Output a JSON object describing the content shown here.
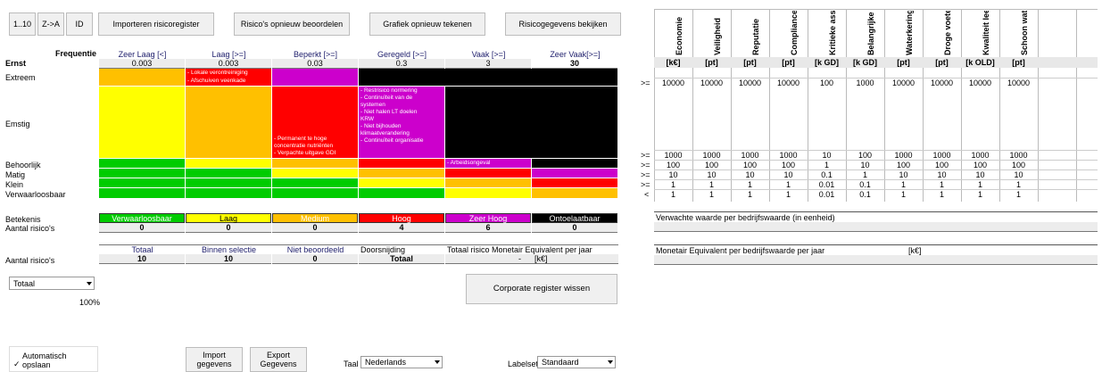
{
  "toolbar": {
    "sort_num": "1..10",
    "sort_az": "Z->A",
    "sort_id": "ID",
    "import_register": "Importeren risicoregister",
    "reassess": "Risico's opnieuw beoordelen",
    "redraw": "Grafiek opnieuw tekenen",
    "view_data": "Risicogegevens bekijken"
  },
  "matrix": {
    "frequency_label": "Frequentie",
    "severity_label": "Ernst",
    "freq_headers": [
      "Zeer Laag [<]",
      "Laag [>=]",
      "Beperkt [>=]",
      "Geregeld [>=]",
      "Vaak [>=]",
      "Zeer Vaak[>=]"
    ],
    "freq_values": [
      "0.003",
      "0.003",
      "0.03",
      "0.3",
      "3",
      "30"
    ],
    "row_labels": [
      "Extreem",
      "Emstig",
      "Behoorlijk",
      "Matig",
      "Klein",
      "Verwaarloosbaar"
    ],
    "cell_texts": {
      "extreem_laag": [
        "- Lokale verontreiniging",
        "- Afschuiven veenkade"
      ],
      "emstig_beperkt": [
        "- Permanent te hoge",
        "concentratie nutriënten",
        "- Verpachte uitgave GDI"
      ],
      "emstig_geregeld": [
        "- Restrisico normering",
        "- Continuïteit van de",
        "systemen",
        "- Niet halen LT doelen",
        "KRW",
        "- Niet bijhouden",
        "klimaatverandering",
        "- Continuïteit organisatie"
      ],
      "behoorlijk_vaak": [
        "- Arbeidsongeval"
      ]
    }
  },
  "legend": {
    "meaning_label": "Betekenis",
    "count_label": "Aantal risico's",
    "levels": [
      "Verwaarloosbaar",
      "Laag",
      "Medium",
      "Hoog",
      "Zeer Hoog",
      "Ontoelaatbaar"
    ],
    "counts": [
      "0",
      "0",
      "0",
      "4",
      "6",
      "0"
    ],
    "colors": [
      "#00cc00",
      "#ffff00",
      "#ffc000",
      "#ff0000",
      "#cc00cc",
      "#000000"
    ]
  },
  "totals": {
    "count_label": "Aantal risico's",
    "headers": [
      "Totaal",
      "Binnen selectie",
      "Niet beoordeeld",
      "Doorsnijding",
      "Totaal risico Monetair Equivalent per jaar"
    ],
    "values": [
      "10",
      "10",
      "0",
      "Totaal",
      "-",
      "[k€]"
    ]
  },
  "filter": {
    "selected": "Totaal",
    "percent": "100%"
  },
  "corporate_button": "Corporate register wissen",
  "bottom": {
    "autosave_line1": "Automatisch",
    "autosave_line2": "opslaan",
    "import_line1": "Import",
    "import_line2": "gegevens",
    "export_line1": "Export",
    "export_line2": "Gegevens",
    "lang_label": "Taal",
    "lang_value": "Nederlands",
    "labelset_label": "Labelset",
    "labelset_value": "Standaard"
  },
  "values_table": {
    "columns": [
      "Economie",
      "Veiligheid",
      "Reputatie",
      "Compliance",
      "Kritieke asse",
      "Belangrijke",
      "Waterkeringe",
      "Droge voete",
      "Kwaliteit lee",
      "Schoon wate"
    ],
    "units": [
      "[k€]",
      "[pt]",
      "[pt]",
      "[pt]",
      "[k GD]",
      "[k GD]",
      "[pt]",
      "[pt]",
      "[k OLD]",
      "[pt]"
    ],
    "operators": [
      ">=",
      ">=",
      ">=",
      ">=",
      ">=",
      "<"
    ],
    "rows": [
      [
        "10000",
        "10000",
        "10000",
        "10000",
        "100",
        "1000",
        "10000",
        "10000",
        "10000",
        "10000"
      ],
      [
        "1000",
        "1000",
        "1000",
        "1000",
        "10",
        "100",
        "1000",
        "1000",
        "1000",
        "1000"
      ],
      [
        "100",
        "100",
        "100",
        "100",
        "1",
        "10",
        "100",
        "100",
        "100",
        "100"
      ],
      [
        "10",
        "10",
        "10",
        "10",
        "0.1",
        "1",
        "10",
        "10",
        "10",
        "10"
      ],
      [
        "1",
        "1",
        "1",
        "1",
        "0.01",
        "0.1",
        "1",
        "1",
        "1",
        "1"
      ],
      [
        "1",
        "1",
        "1",
        "1",
        "0.01",
        "0.1",
        "1",
        "1",
        "1",
        "1"
      ]
    ],
    "expected_label": "Verwachte waarde per bedrijfswaarde (in eenheid)",
    "monetary_label": "Monetair Equivalent per bedrijfswaarde per jaar",
    "monetary_unit": "[k€]",
    "dash": "-"
  }
}
